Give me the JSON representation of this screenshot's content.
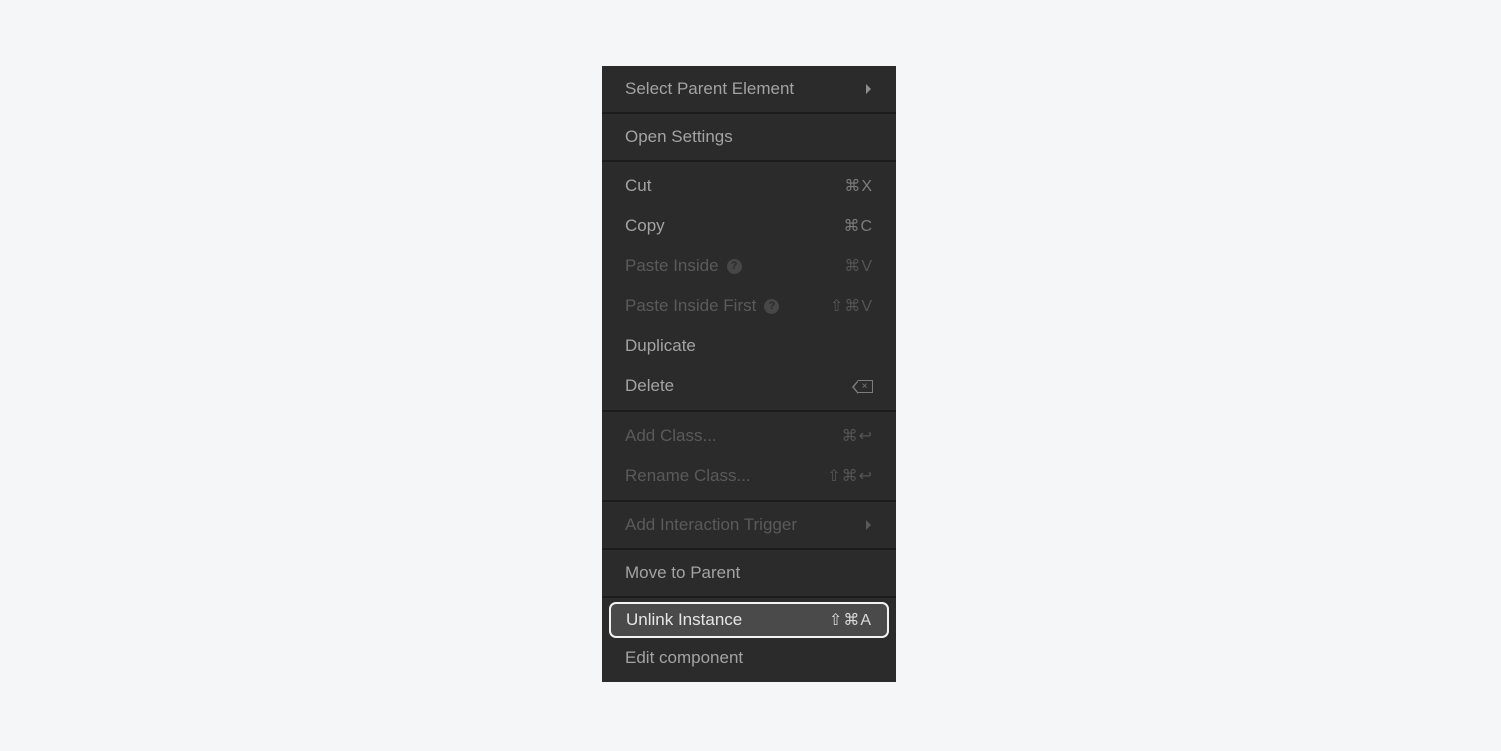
{
  "menu": {
    "sections": [
      {
        "items": [
          {
            "label": "Select Parent Element",
            "submenu": true,
            "disabled": false
          }
        ]
      },
      {
        "items": [
          {
            "label": "Open Settings",
            "disabled": false
          }
        ]
      },
      {
        "items": [
          {
            "label": "Cut",
            "shortcut": "⌘X",
            "disabled": false
          },
          {
            "label": "Copy",
            "shortcut": "⌘C",
            "disabled": false
          },
          {
            "label": "Paste Inside",
            "shortcut": "⌘V",
            "help": "?",
            "disabled": true
          },
          {
            "label": "Paste Inside First",
            "shortcut": "⇧⌘V",
            "help": "?",
            "disabled": true
          },
          {
            "label": "Duplicate",
            "disabled": false
          },
          {
            "label": "Delete",
            "shortcut_icon": "backspace-icon",
            "disabled": false
          }
        ]
      },
      {
        "items": [
          {
            "label": "Add Class...",
            "shortcut": "⌘↩",
            "disabled": true
          },
          {
            "label": "Rename Class...",
            "shortcut": "⇧⌘↩",
            "disabled": true
          }
        ]
      },
      {
        "items": [
          {
            "label": "Add Interaction Trigger",
            "submenu": true,
            "disabled": true
          }
        ]
      },
      {
        "items": [
          {
            "label": "Move to Parent",
            "disabled": false
          }
        ]
      },
      {
        "items": [
          {
            "label": "Unlink Instance",
            "shortcut": "⇧⌘A",
            "active": true,
            "disabled": false
          },
          {
            "label": "Edit component",
            "disabled": false
          }
        ]
      }
    ]
  }
}
